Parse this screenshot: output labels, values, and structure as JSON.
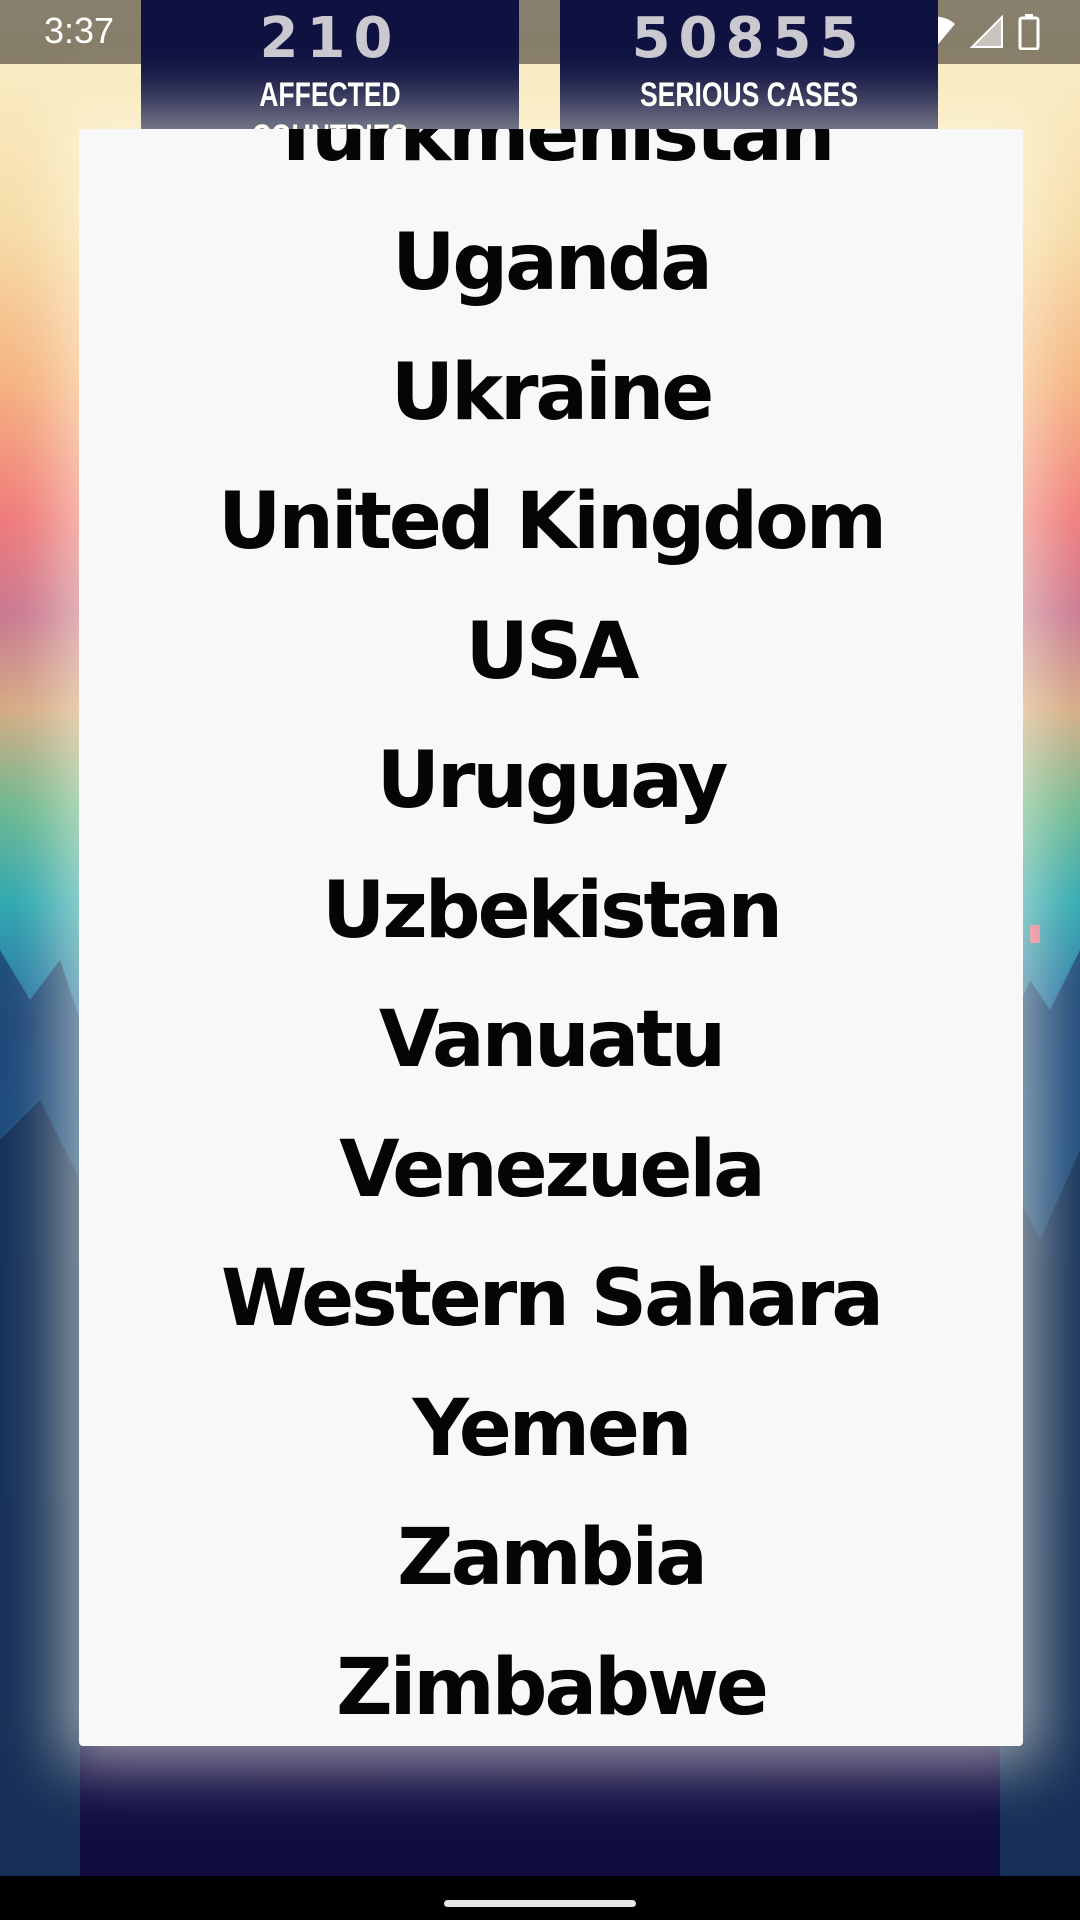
{
  "status_bar": {
    "time": "3:37",
    "icons": [
      "gallery-icon",
      "vibrate-icon",
      "wifi-icon",
      "cell-signal-icon",
      "battery-icon"
    ]
  },
  "stats": {
    "affected_countries": {
      "value": "210",
      "label": "AFFECTED COUNTRIES"
    },
    "serious_cases": {
      "value": "50855",
      "label": "SERIOUS CASES"
    }
  },
  "country_list": {
    "items": [
      "Turkmenistan",
      "Uganda",
      "Ukraine",
      "United Kingdom",
      "USA",
      "Uruguay",
      "Uzbekistan",
      "Vanuatu",
      "Venezuela",
      "Western Sahara",
      "Yemen",
      "Zambia",
      "Zimbabwe"
    ]
  },
  "colors": {
    "stat_card_bg": "#0f1240",
    "panel_bg": "#f8f8fa",
    "list_text": "#050505"
  }
}
